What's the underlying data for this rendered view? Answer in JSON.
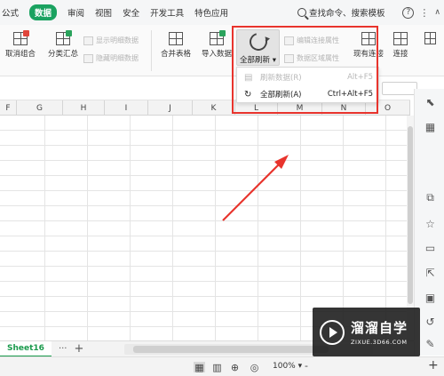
{
  "menu": {
    "items": [
      "公式",
      "数据",
      "审阅",
      "视图",
      "安全",
      "开发工具",
      "特色应用"
    ],
    "active": "数据",
    "search_text": "查找命令、搜索模板",
    "help": "?",
    "more": "⋮"
  },
  "ribbon": {
    "ungroup": "取消组合",
    "subtotal": "分类汇总",
    "show_detail": "显示明细数据",
    "hide_detail": "隐藏明细数据",
    "merge_tables": "合并表格",
    "import_data": "导入数据",
    "refresh_all": "全部刷新",
    "edit_connection": "编辑连接属性",
    "data_range": "数据区域属性",
    "existing_connection": "现有连接",
    "connect": "连接"
  },
  "dropdown": {
    "items": [
      {
        "label": "刷新数据(R)",
        "shortcut": "Alt+F5",
        "enabled": false
      },
      {
        "label": "全部刷新(A)",
        "shortcut": "Ctrl+Alt+F5",
        "enabled": true
      }
    ]
  },
  "columns": [
    "F",
    "G",
    "H",
    "I",
    "J",
    "K",
    "L",
    "M",
    "N",
    "O"
  ],
  "sheet": {
    "active_tab": "Sheet16",
    "more": "···",
    "add": "+"
  },
  "status": {
    "zoom": "100%",
    "zoom_minus": "-",
    "zoom_plus": "+"
  },
  "watermark": {
    "title": "溜溜自学",
    "url": "ZIXUE.3D66.COM"
  },
  "colors": {
    "accent_green": "#1aa260",
    "highlight_red": "#e8342d"
  }
}
